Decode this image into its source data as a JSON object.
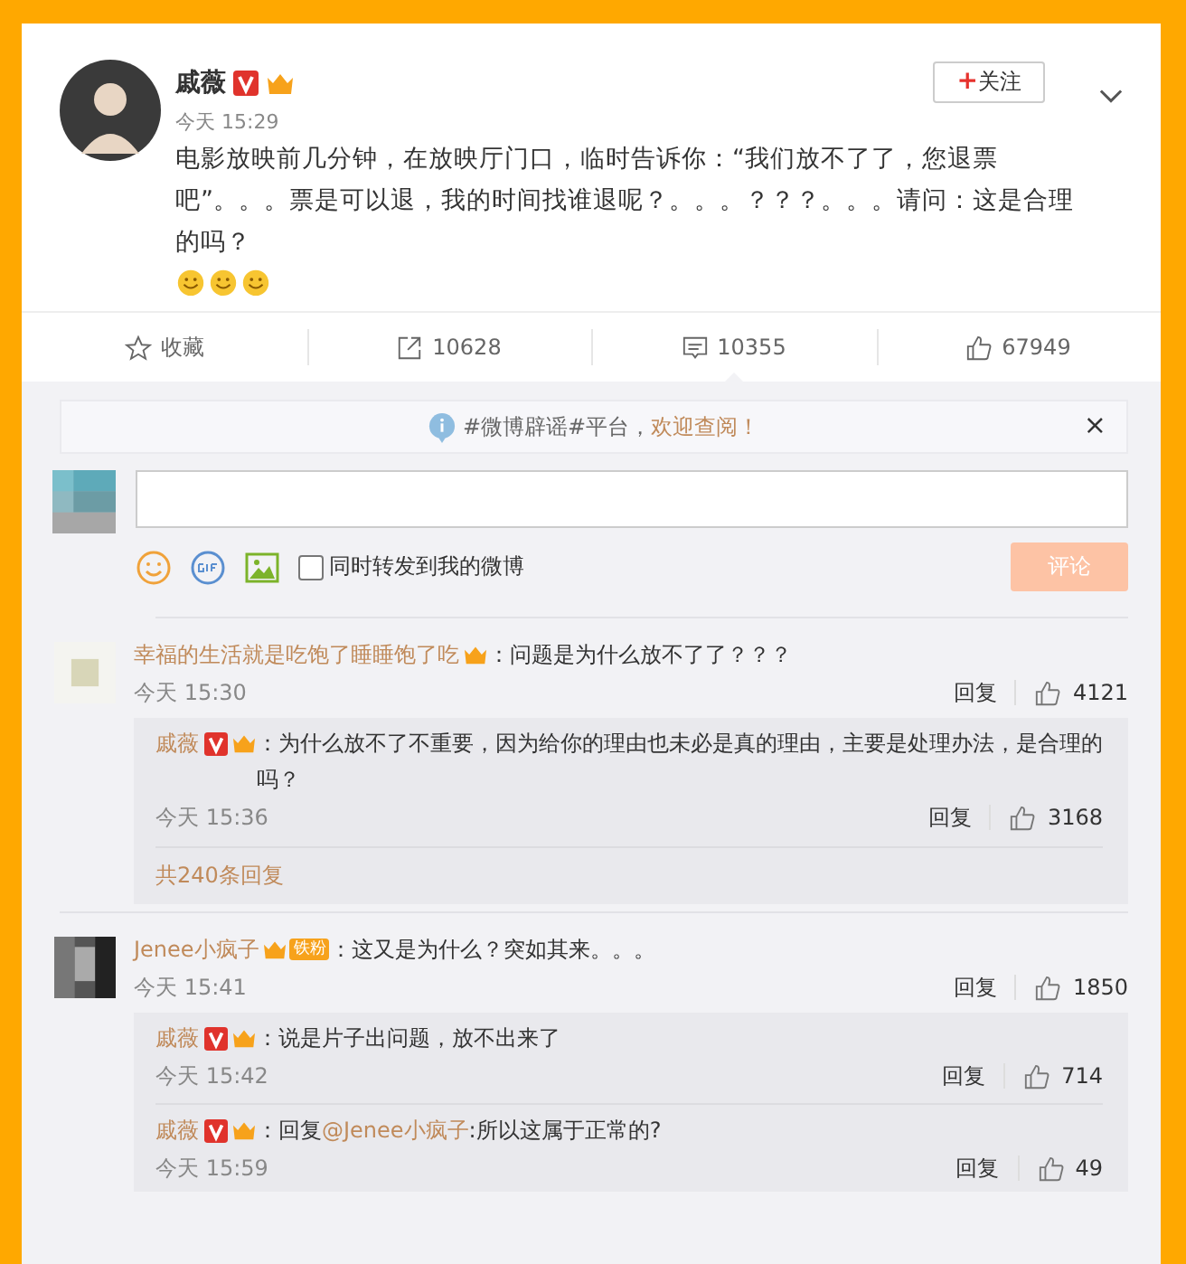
{
  "post": {
    "author": "戚薇",
    "verified": true,
    "vip": true,
    "time": "今天 15:29",
    "follow_button": "关注",
    "follow_plus": "+",
    "text": "电影放映前几分钟，在放映厅门口，临时告诉你：“我们放不了了，您退票吧”。。。票是可以退，我的时间找谁退呢？。。。？？？。。。请问：这是合理的吗？"
  },
  "actions": [
    {
      "kind": "favorite",
      "label": "收藏"
    },
    {
      "kind": "share",
      "label": "10628"
    },
    {
      "kind": "comment",
      "label": "10355",
      "selected": true
    },
    {
      "kind": "like",
      "label": "67949"
    }
  ],
  "notice": {
    "text": "#微博辟谣#平台，",
    "link": "欢迎查阅！",
    "close": "×"
  },
  "composer": {
    "sync_label": "同时转发到我的微博",
    "checked": false,
    "submit": "评论"
  },
  "comments": [
    {
      "user": "幸福的生活就是吃饱了睡睡饱了吃",
      "vip": true,
      "text": "：问题是为什么放不了了？？？",
      "time": "今天 15:30",
      "reply": "回复",
      "likes": "4121",
      "replies": [
        {
          "user": "戚薇",
          "verified": true,
          "vip": true,
          "text": "：为什么放不了不重要，因为给你的理由也未必是真的理由，主要是处理办法，是合理的吗？",
          "time": "今天 15:36",
          "reply": "回复",
          "likes": "3168"
        }
      ],
      "more": "共240条回复"
    },
    {
      "user": "Jenee小疯子",
      "vip": true,
      "fan_badge": "铁粉",
      "text": "：这又是为什么？突如其来。。。",
      "time": "今天 15:41",
      "reply": "回复",
      "likes": "1850",
      "replies": [
        {
          "user": "戚薇",
          "verified": true,
          "vip": true,
          "text": "：说是片子出问题，放不出来了",
          "time": "今天 15:42",
          "reply": "回复",
          "likes": "714"
        },
        {
          "user": "戚薇",
          "verified": true,
          "vip": true,
          "prefix": "：回复",
          "mention": "@Jenee小疯子",
          "text": ":所以这属于正常的?",
          "time": "今天 15:59",
          "reply": "回复",
          "likes": "49"
        }
      ]
    }
  ]
}
